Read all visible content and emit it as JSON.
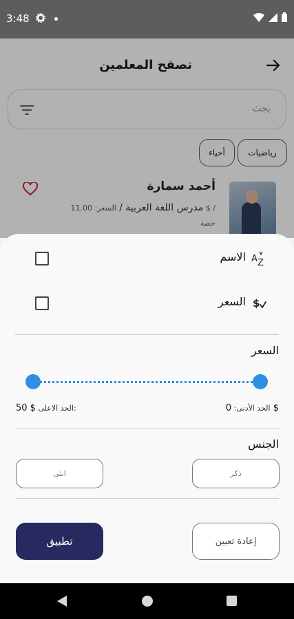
{
  "status_bar": {
    "time": "3:48"
  },
  "header": {
    "title": "تصفح المعلمين"
  },
  "search": {
    "placeholder": "بحث"
  },
  "chips": [
    {
      "label": "رياضيات"
    },
    {
      "label": "أحياء"
    }
  ],
  "teacher": {
    "name": "أحمد سمارة",
    "subject": "مدرس اللغة العربية /",
    "price": "السعر: 11.00 $ /",
    "unit": "حصة"
  },
  "sheet": {
    "sort_name_label": "الاسم",
    "sort_price_label": "السعر",
    "price_section_title": "السعر",
    "min_label": "الحد الأدنى:",
    "min_value": "0 $",
    "max_label": "الحد الاعلى:",
    "max_value": "50 $",
    "gender_section_title": "الجنس",
    "gender_male": "ذكر",
    "gender_female": "انثى",
    "apply_label": "تطبيق",
    "reset_label": "إعادة تعيين"
  },
  "colors": {
    "accent": "#2f8de4",
    "primary": "#262a5e",
    "heart": "#c0262e"
  }
}
